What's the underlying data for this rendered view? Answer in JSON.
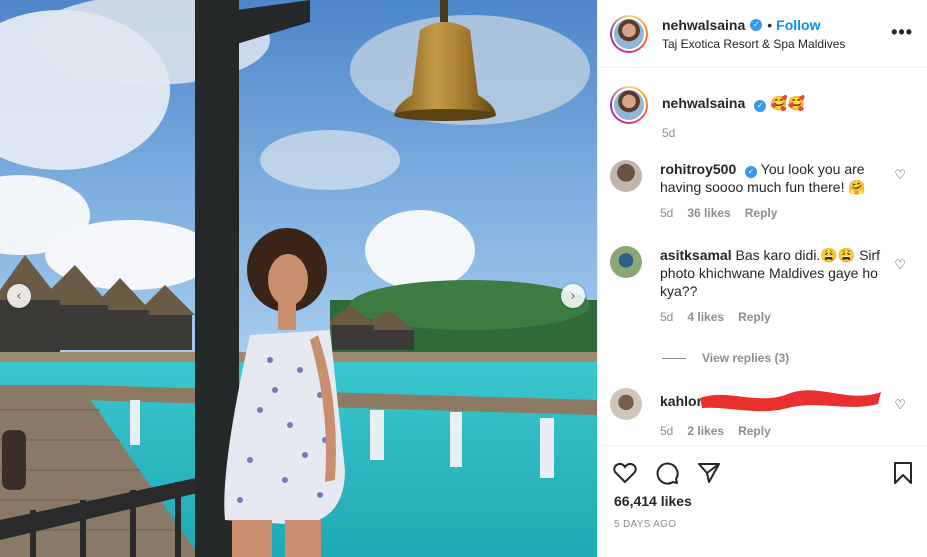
{
  "post": {
    "username": "nehwalsaina",
    "verified_mark": "✓",
    "separator": "•",
    "follow_label": "Follow",
    "location": "Taj Exotica Resort & Spa Maldives",
    "more_label": "•••"
  },
  "caption": {
    "username": "nehwalsaina",
    "text": "🥰🥰",
    "age": "5d"
  },
  "comments": [
    {
      "username": "rohitroy500",
      "verified": true,
      "text": "You look you are having soooo much fun there! 🤗",
      "age": "5d",
      "likes": "36 likes",
      "reply": "Reply"
    },
    {
      "username": "asitksamal",
      "verified": false,
      "text": "Bas karo didi.😩😩 Sirf photo khichwane Maldives gaye ho kya??",
      "age": "5d",
      "likes": "4 likes",
      "reply": "Reply",
      "view_replies": "View replies (3)"
    },
    {
      "username": "kahlon",
      "verified": false,
      "text": "",
      "age": "5d",
      "likes": "2 likes",
      "reply": "Reply"
    }
  ],
  "footer": {
    "likes": "66,414 likes",
    "date": "5 DAYS AGO"
  },
  "carousel": {
    "prev": "‹",
    "next": "›"
  },
  "icons": [
    "heart-icon",
    "comment-icon",
    "share-icon",
    "bookmark-icon"
  ],
  "colors": {
    "follow": "#0095f6",
    "verified": "#3897f0",
    "muted": "#8e8e8e",
    "redaction": "#e8302f"
  }
}
